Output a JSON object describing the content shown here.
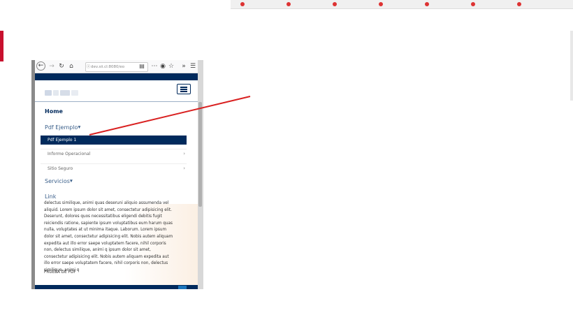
{
  "browser": {
    "url": "dev.sii.cl:8080/eo",
    "background_tabs": [
      "",
      "",
      "",
      "",
      "",
      "",
      ""
    ]
  },
  "site": {
    "nav": {
      "home": "Home",
      "pdf_ejemplo": "Pdf Ejemplo",
      "submenu": {
        "active": "Pdf Ejemplo 1",
        "items": [
          "Informe Operacional",
          "Sitio Seguro"
        ]
      },
      "servicios": "Servicios",
      "link": "Link"
    },
    "content": {
      "paragraph": "delectus similique, animi quas deseruni aliquio assumenda vel aliquid. Lorem ipsum dolor sit amet, consectetur adipisicing elit. Deserunt, dolores quos necessitatibus eligendi debitis fugit reiciendis ratione, sapiente ipsum voluptatibus eum harum quas nulla, voluptates at ut minima itaque. Laborum. Lorem ipsum dolor sit amet, consectetur adipisicing elit. Nobis autem aliquam expedita aut illo error saepe voluptatem facere, nihil corporis non, delectus similique, animi q ipsum dolor sit amet, consectetur adipisicing elit. Nobis autem aliquam expedita aut illo error saepe voluptatem facere, nihil corporis non, delectus similique, animi q",
      "pdf_label": "PRUEBA DE PDF"
    }
  },
  "colors": {
    "brand_navy": "#002a5c",
    "annotation_arrow": "#d92020"
  },
  "icons": [
    "back-icon",
    "forward-icon",
    "reload-icon",
    "home-icon",
    "info-icon",
    "reader-icon",
    "more-icon",
    "pocket-icon",
    "bookmark-star-icon",
    "overflow-icon",
    "menu-icon",
    "hamburger-icon"
  ]
}
